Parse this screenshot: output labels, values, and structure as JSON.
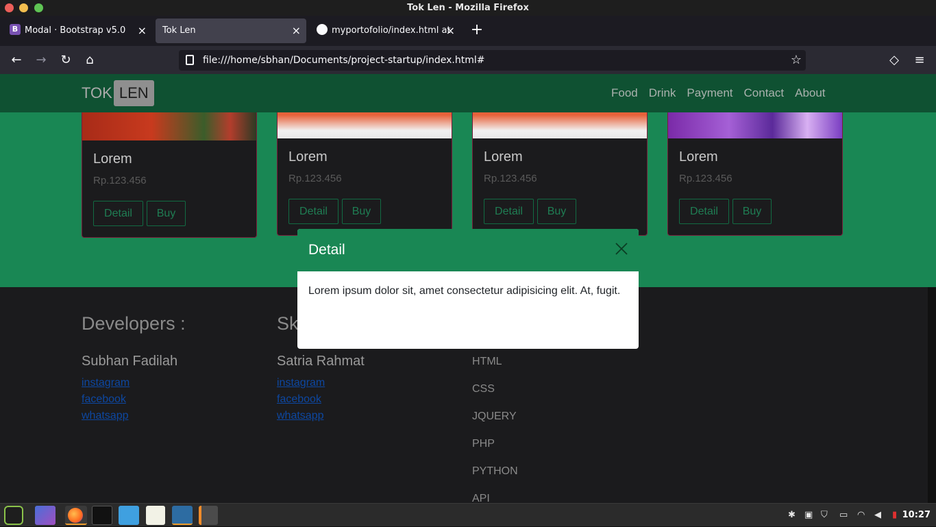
{
  "window": {
    "title": "Tok Len - Mozilla Firefox"
  },
  "tabs": [
    {
      "label": "Modal · Bootstrap v5.0",
      "favicon": "B",
      "active": false
    },
    {
      "label": "Tok Len",
      "active": true
    },
    {
      "label": "myportofolio/index.html at",
      "active": false
    }
  ],
  "tab_close": "×",
  "new_tab": "+",
  "toolbar": {
    "back": "←",
    "forward": "→",
    "reload": "↻",
    "home": "⌂",
    "url": "file:///home/sbhan/Documents/project-startup/index.html#",
    "bookmark": "☆",
    "pocket": "◇",
    "menu": "≡"
  },
  "site": {
    "brand_1": "TOK",
    "brand_2": "LEN",
    "nav": [
      "Food",
      "Drink",
      "Payment",
      "Contact",
      "About"
    ]
  },
  "cards": [
    {
      "title": "Lorem",
      "price": "Rp.123.456",
      "detail": "Detail",
      "buy": "Buy"
    },
    {
      "title": "Lorem",
      "price": "Rp.123.456",
      "detail": "Detail",
      "buy": "Buy"
    },
    {
      "title": "Lorem",
      "price": "Rp.123.456",
      "detail": "Detail",
      "buy": "Buy"
    },
    {
      "title": "Lorem",
      "price": "Rp.123.456",
      "detail": "Detail",
      "buy": "Buy"
    }
  ],
  "footer": {
    "developers_heading": "Developers :",
    "skills_heading": "Sk",
    "devs": [
      {
        "name": "Subhan Fadilah",
        "links": [
          "instagram",
          "facebook",
          "whatsapp"
        ]
      },
      {
        "name": "Satria Rahmat",
        "links": [
          "instagram",
          "facebook",
          "whatsapp"
        ]
      }
    ],
    "skills": [
      "HTML",
      "CSS",
      "JQUERY",
      "PHP",
      "PYTHON",
      "API"
    ]
  },
  "modal": {
    "title": "Detail",
    "body": "Lorem ipsum dolor sit, amet consectetur adipisicing elit. At, fugit."
  },
  "taskbar": {
    "menu_icon": "mint-menu-icon",
    "apps": [
      "desktop",
      "firefox",
      "terminal",
      "files",
      "text-editor",
      "vscode",
      "sublime"
    ],
    "clock": "10:27"
  }
}
